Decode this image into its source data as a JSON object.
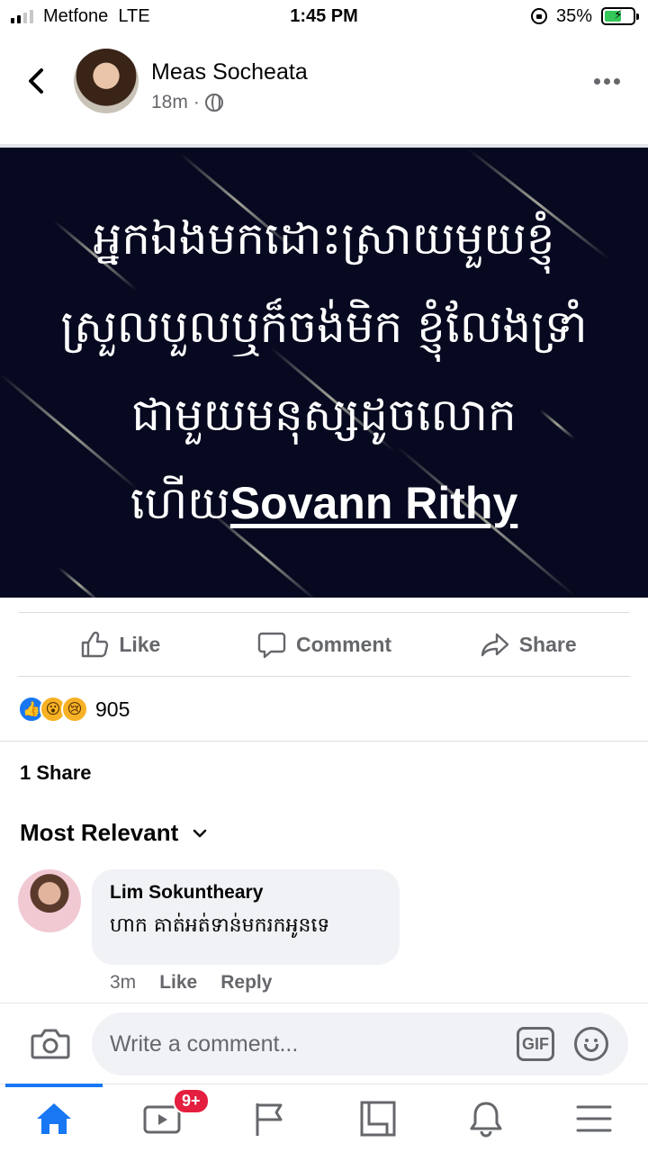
{
  "status_bar": {
    "carrier": "Metfone",
    "network": "LTE",
    "time": "1:45 PM",
    "battery_percent": "35%",
    "battery_level": 0.35,
    "signal_bars": 2
  },
  "post": {
    "author": "Meas Socheata",
    "time_ago": "18m",
    "separator": "·",
    "privacy_icon": "globe-icon",
    "image_text_lines": [
      "អ្នកឯងមកដោះស្រាយមួយខ្ញុំ",
      "ស្រួលបួលឬក៏ចង់មិក ខ្ញុំលែងទ្រាំ",
      "ជាមួយមនុស្សដូចលោក"
    ],
    "image_text_last_prefix": "ហើយ",
    "image_text_highlight": "Sovann Rithy",
    "image_background": "#06091f"
  },
  "actions": {
    "like": "Like",
    "comment": "Comment",
    "share": "Share"
  },
  "reactions": {
    "count": "905",
    "types": [
      "like-icon",
      "wow-icon",
      "sad-icon"
    ],
    "like_color": "#1877f2"
  },
  "shares": "1 Share",
  "sort": {
    "label": "Most Relevant"
  },
  "comments": [
    {
      "author": "Lim Sokuntheary",
      "text": "ហាក គាត់អត់ទាន់មករកអូនទេ",
      "time_ago": "3m",
      "like_label": "Like",
      "reply_label": "Reply"
    }
  ],
  "composer": {
    "placeholder": "Write a comment...",
    "gif_label": "GIF"
  },
  "bottom_nav": {
    "items": [
      "home-icon",
      "watch-icon",
      "pages-icon",
      "marketplace-icon",
      "notifications-icon",
      "menu-icon"
    ],
    "watch_badge": "9+",
    "active": "home-icon",
    "accent": "#1877f2"
  }
}
